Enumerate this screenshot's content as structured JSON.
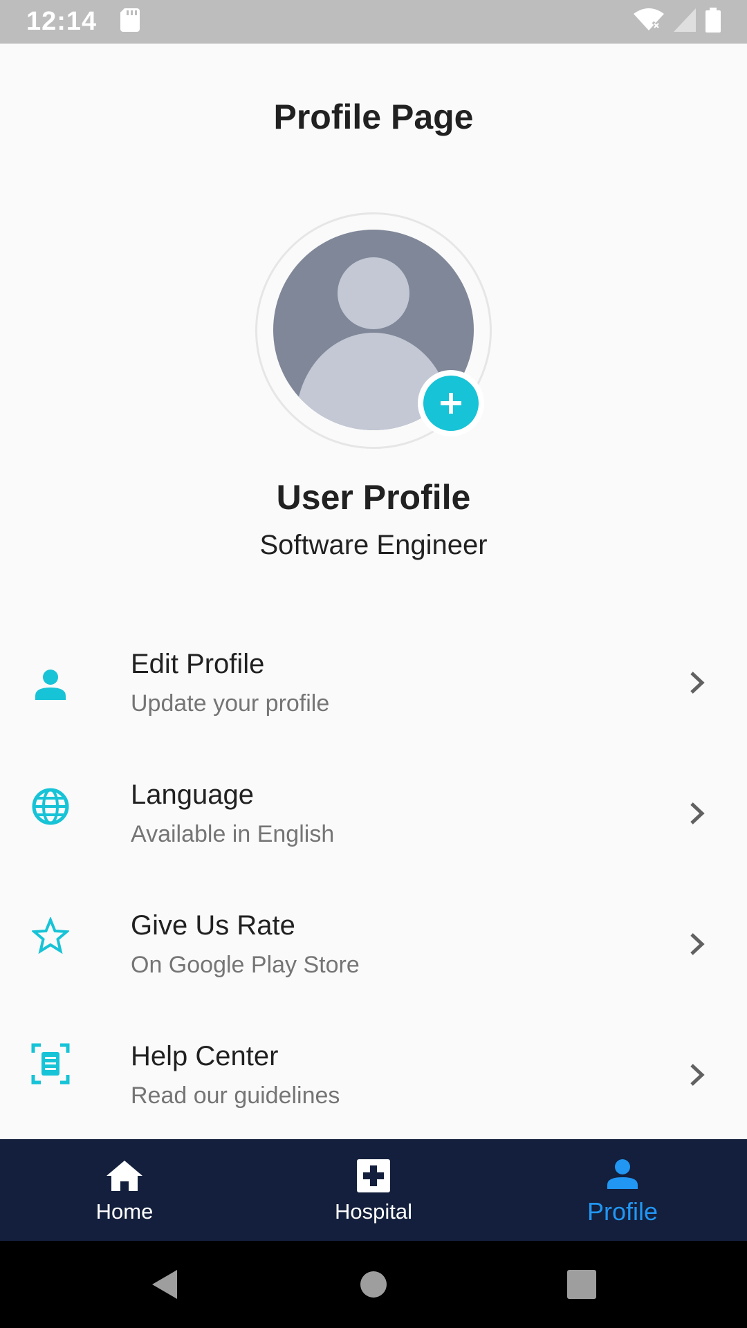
{
  "status_bar": {
    "time": "12:14",
    "icons": [
      "sd-card-icon",
      "wifi-icon",
      "signal-icon",
      "battery-icon"
    ]
  },
  "page": {
    "title": "Profile Page"
  },
  "profile": {
    "name": "User Profile",
    "role": "Software Engineer",
    "avatar_icon": "person-placeholder-icon",
    "add_photo_icon": "plus-icon"
  },
  "menu": {
    "items": [
      {
        "title": "Edit Profile",
        "subtitle": "Update your profile",
        "icon": "person-icon"
      },
      {
        "title": "Language",
        "subtitle": "Available in English",
        "icon": "globe-icon"
      },
      {
        "title": "Give Us Rate",
        "subtitle": "On Google Play Store",
        "icon": "star-outline-icon"
      },
      {
        "title": "Help Center",
        "subtitle": "Read our guidelines",
        "icon": "document-scan-icon"
      }
    ]
  },
  "bottom_nav": {
    "items": [
      {
        "label": "Home",
        "icon": "home-icon",
        "active": false
      },
      {
        "label": "Hospital",
        "icon": "hospital-cross-icon",
        "active": false
      },
      {
        "label": "Profile",
        "icon": "person-icon",
        "active": true
      }
    ]
  },
  "colors": {
    "accent": "#17C3D6",
    "nav_background": "#131F3C",
    "nav_active": "#2196F3",
    "background": "#FAFAFA"
  }
}
